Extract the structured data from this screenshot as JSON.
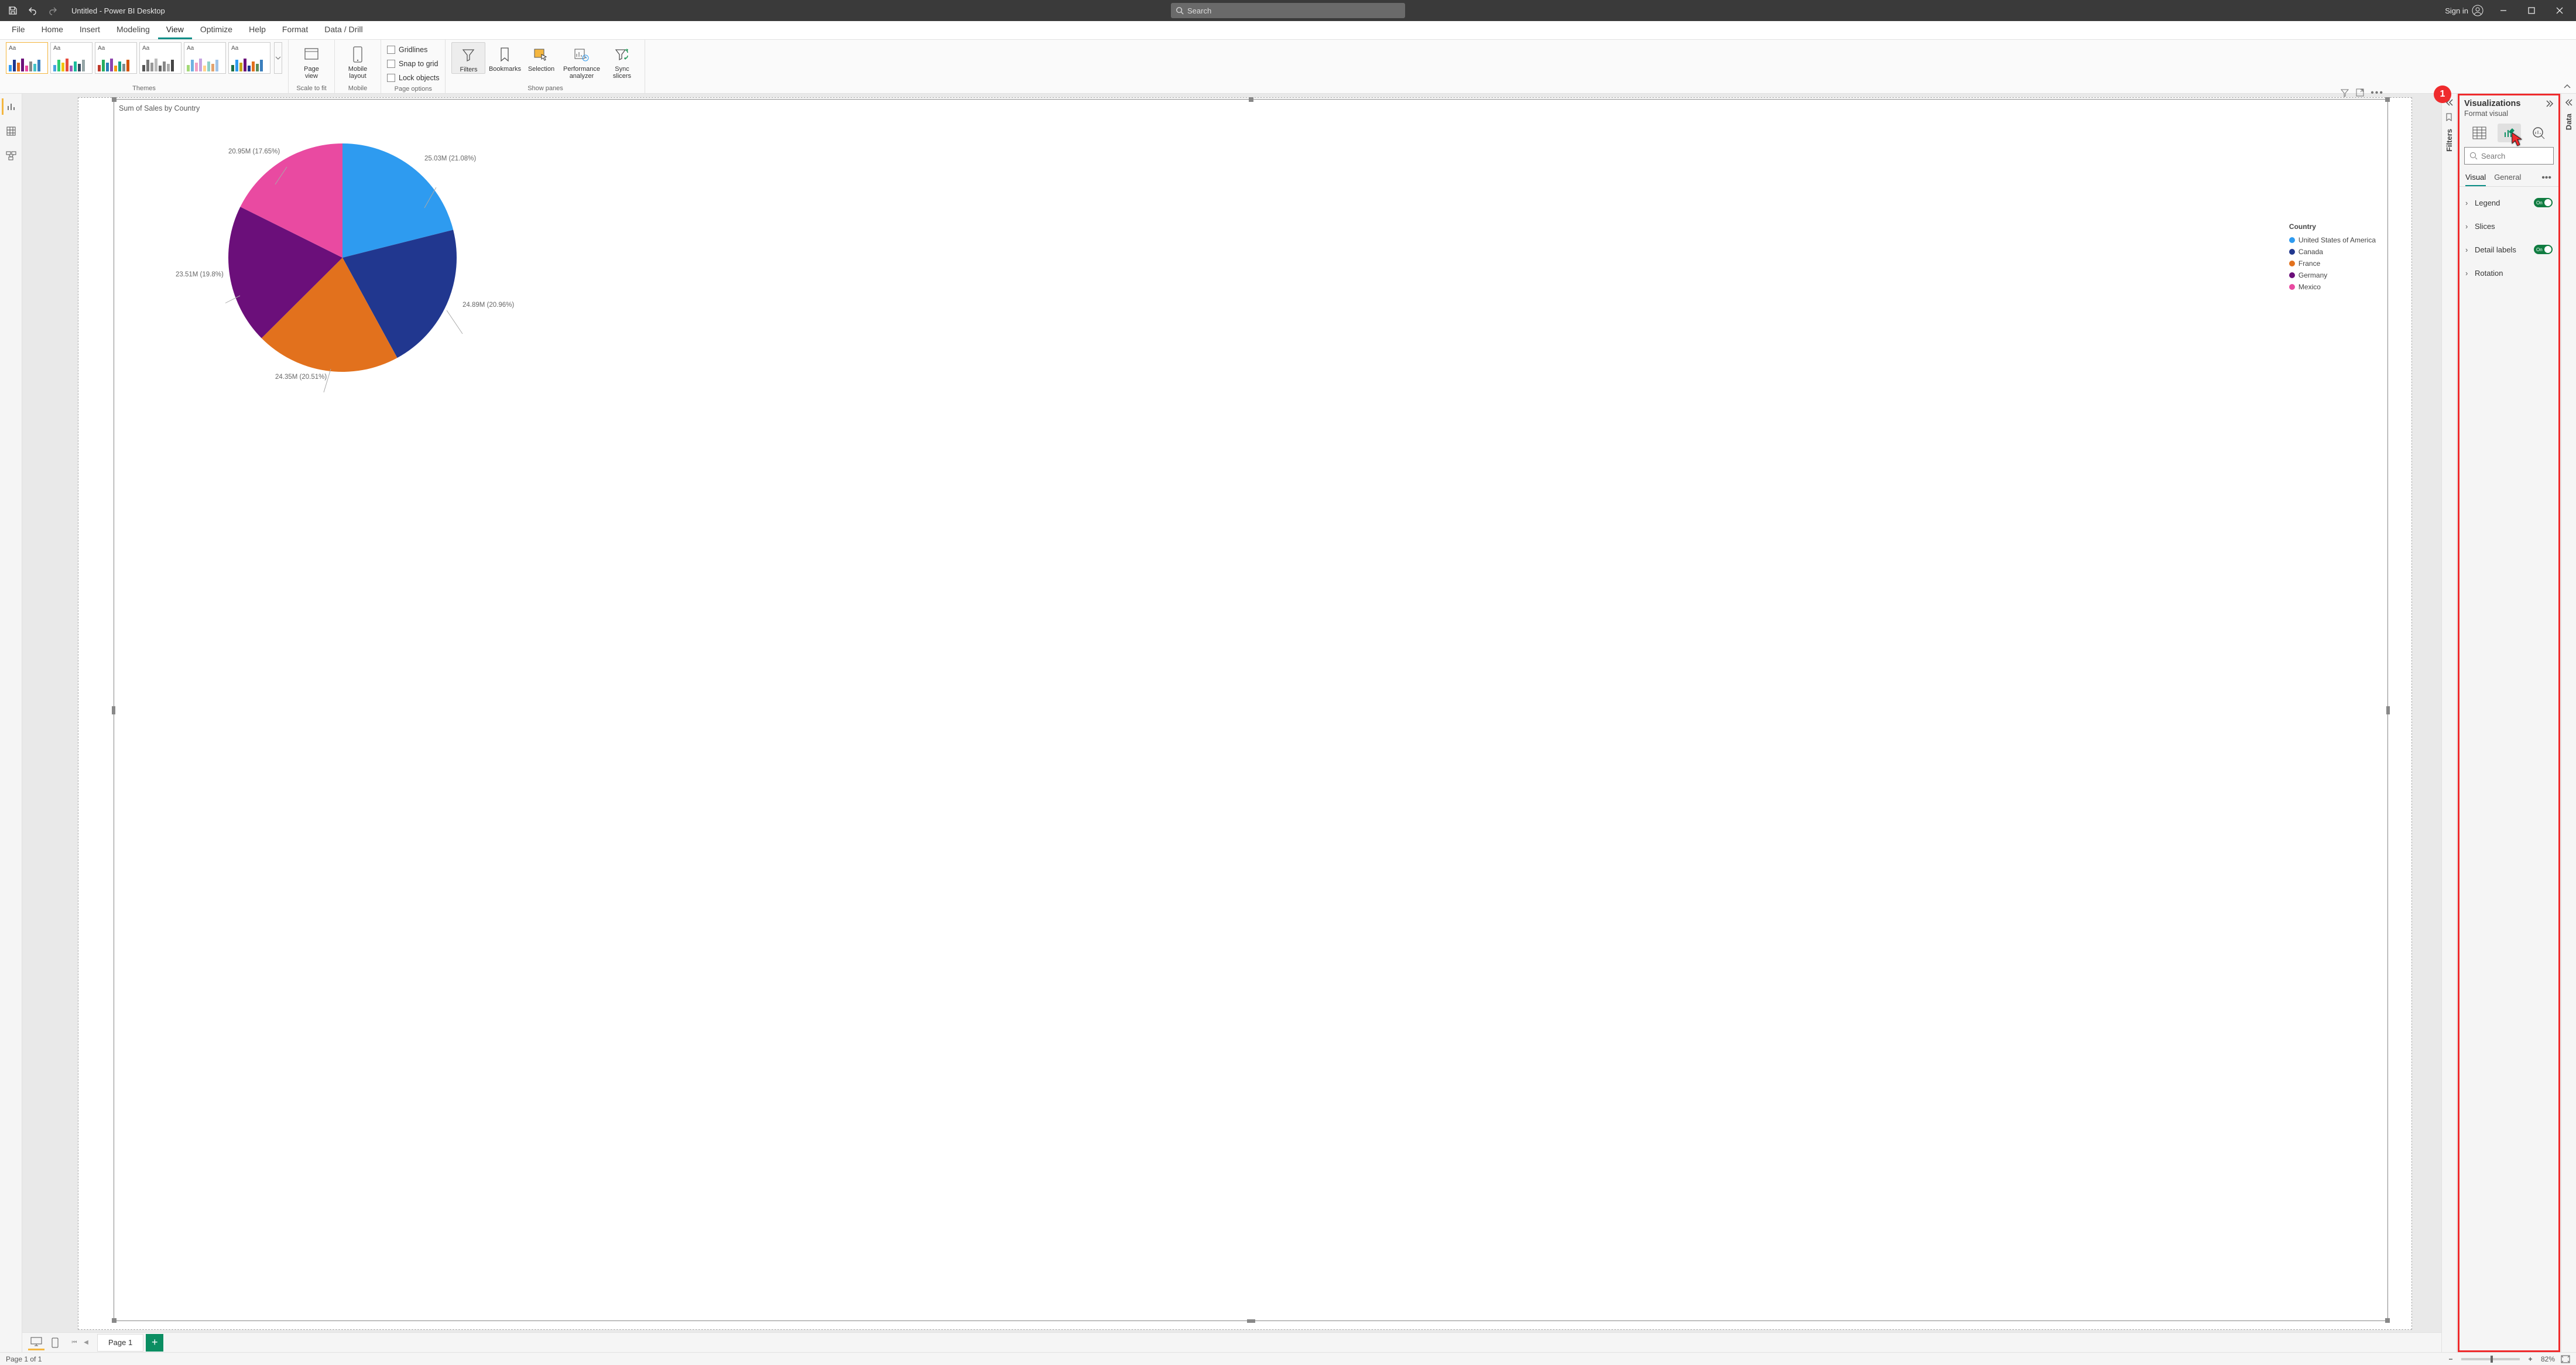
{
  "titlebar": {
    "title": "Untitled - Power BI Desktop",
    "search_placeholder": "Search",
    "signin": "Sign in"
  },
  "ribbon_tabs": {
    "file": "File",
    "home": "Home",
    "insert": "Insert",
    "modeling": "Modeling",
    "view": "View",
    "optimize": "Optimize",
    "help": "Help",
    "format": "Format",
    "data_drill": "Data / Drill"
  },
  "ribbon": {
    "themes_label": "Themes",
    "scale_to_fit": "Scale to fit",
    "mobile": "Mobile",
    "page_view": "Page\nview",
    "mobile_layout": "Mobile\nlayout",
    "page_options_label": "Page options",
    "gridlines": "Gridlines",
    "snap_to_grid": "Snap to grid",
    "lock_objects": "Lock objects",
    "show_panes_label": "Show panes",
    "filters": "Filters",
    "bookmarks": "Bookmarks",
    "selection": "Selection",
    "perf_analyzer": "Performance\nanalyzer",
    "sync_slicers": "Sync\nslicers"
  },
  "panes": {
    "filters": "Filters",
    "visualizations": "Visualizations",
    "format_visual": "Format visual",
    "data": "Data",
    "search_placeholder": "Search",
    "tab_visual": "Visual",
    "tab_general": "General",
    "legend": "Legend",
    "slices": "Slices",
    "detail_labels": "Detail labels",
    "rotation": "Rotation",
    "toggle_on": "On"
  },
  "callout": {
    "num": "1"
  },
  "chart_data": {
    "type": "pie",
    "title": "Sum of Sales by Country",
    "legend_title": "Country",
    "series": [
      {
        "name": "United States of America",
        "value": 25.03,
        "percent": 21.08,
        "color": "#2e9bf0",
        "label": "25.03M (21.08%)"
      },
      {
        "name": "Canada",
        "value": 24.89,
        "percent": 20.96,
        "color": "#21378f",
        "label": "24.89M (20.96%)"
      },
      {
        "name": "France",
        "value": 24.35,
        "percent": 20.51,
        "color": "#e2711d",
        "label": "24.35M (20.51%)"
      },
      {
        "name": "Germany",
        "value": 23.51,
        "percent": 19.8,
        "color": "#6b0f7a",
        "label": "23.51M (19.8%)"
      },
      {
        "name": "Mexico",
        "value": 20.95,
        "percent": 17.65,
        "color": "#e94aa1",
        "label": "20.95M (17.65%)"
      }
    ]
  },
  "pagebar": {
    "page1": "Page 1"
  },
  "statusbar": {
    "page_info": "Page 1 of 1",
    "zoom": "82%"
  }
}
